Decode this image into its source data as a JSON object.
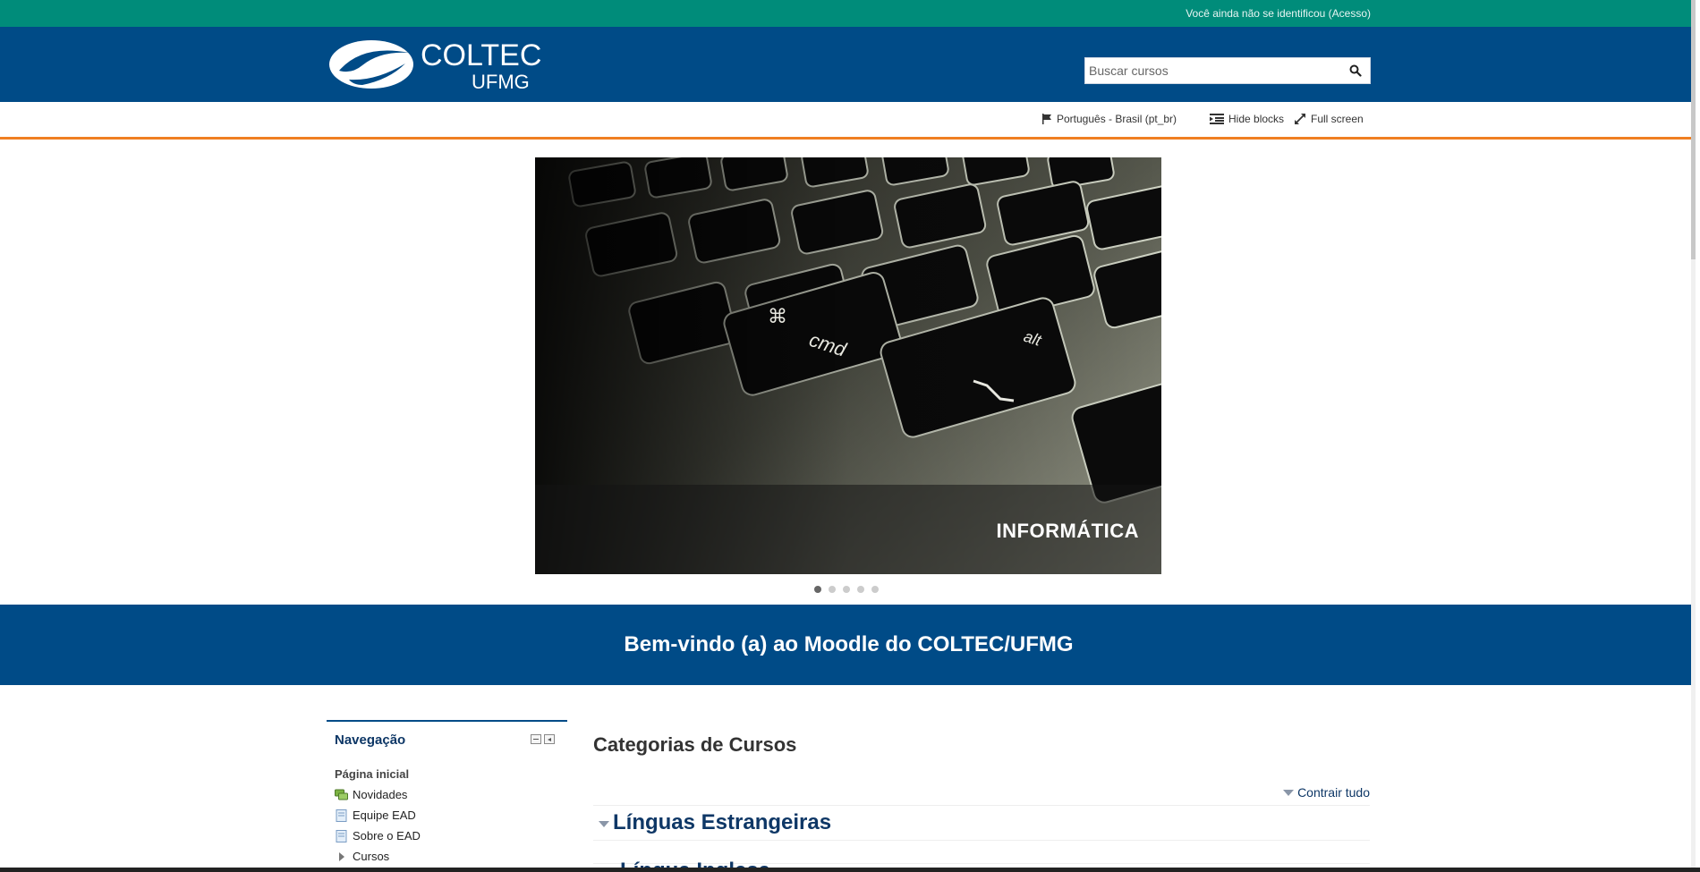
{
  "topbar": {
    "login_text": "Você ainda não se identificou (Acesso)"
  },
  "header": {
    "logo_line1": "COLTEC",
    "logo_line2": "UFMG",
    "search_placeholder": "Buscar cursos",
    "search_icon": "search-icon"
  },
  "utilbar": {
    "language": "Português - Brasil (pt_br)",
    "hide_blocks": "Hide blocks",
    "full_screen": "Full screen"
  },
  "slider": {
    "caption": "INFORMÁTICA",
    "key_labels": [
      "cmd",
      "alt"
    ],
    "dot_count": 5,
    "active_dot": 0
  },
  "welcome": {
    "title": "Bem-vindo (a) ao Moodle do COLTEC/UFMG"
  },
  "navigation": {
    "title": "Navegação",
    "home": "Página inicial",
    "items": [
      {
        "label": "Novidades",
        "icon": "forum-icon"
      },
      {
        "label": "Equipe EAD",
        "icon": "page-icon"
      },
      {
        "label": "Sobre o EAD",
        "icon": "page-icon"
      },
      {
        "label": "Cursos",
        "icon": "expand-arrow-icon"
      }
    ]
  },
  "main": {
    "title": "Categorias de Cursos",
    "collapse_all": "Contrair tudo",
    "category": "Línguas Estrangeiras",
    "subcategory": "Língua Inglesa"
  },
  "colors": {
    "topbar": "#008c7a",
    "header": "#004b87",
    "accent_line": "#f07f22",
    "link": "#0e3766"
  }
}
